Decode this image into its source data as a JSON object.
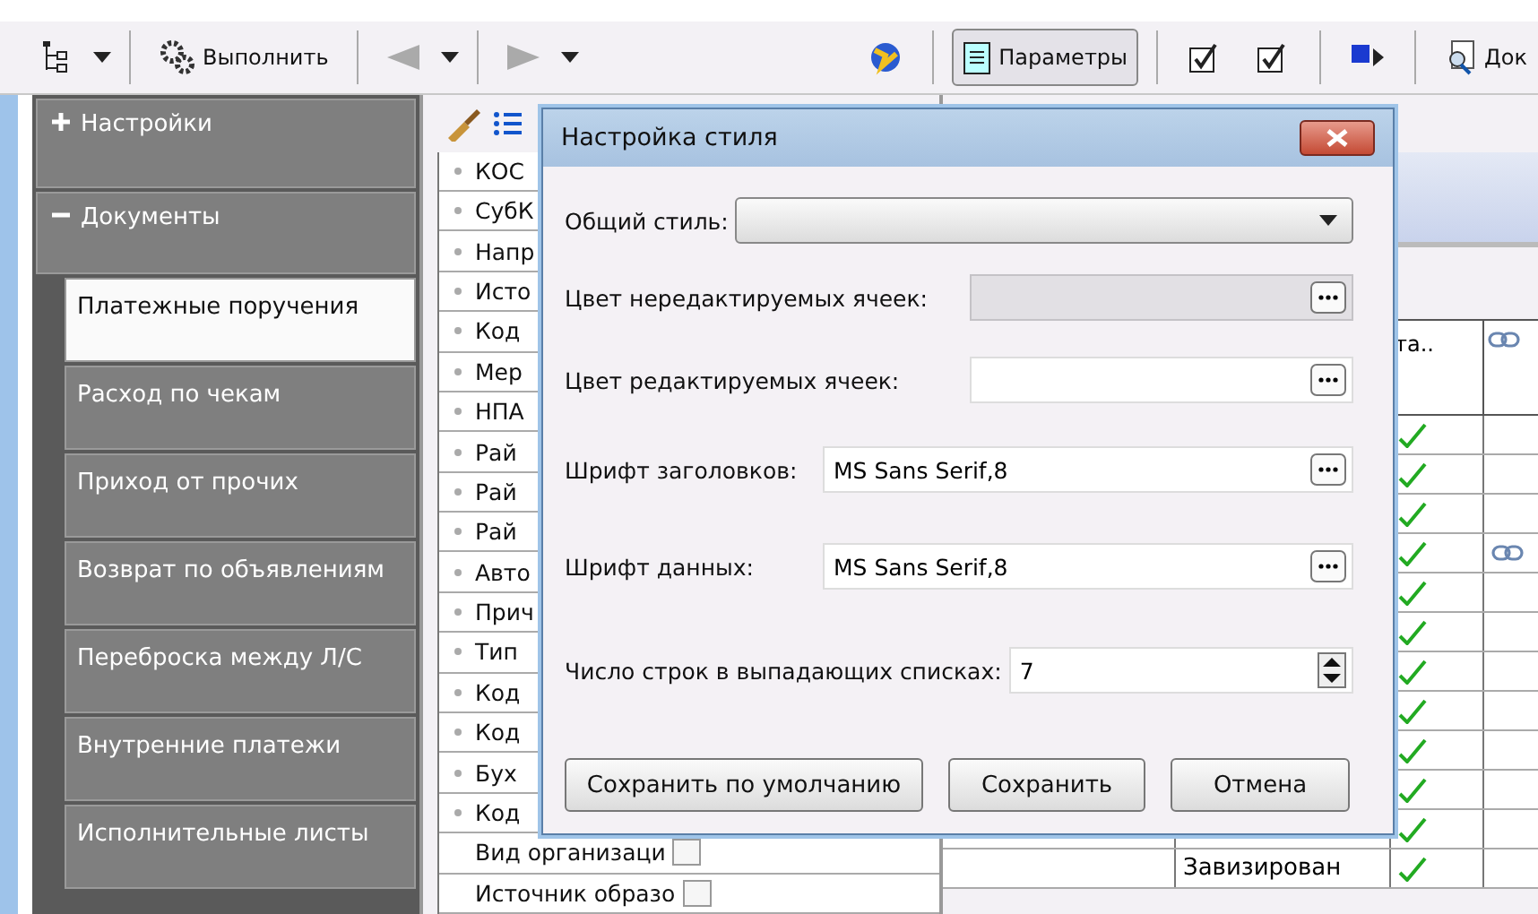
{
  "toolbar": {
    "execute_label": "Выполнить",
    "back_disabled": true,
    "forward_disabled": true,
    "params": {
      "label": "Параметры",
      "pressed": true
    },
    "doc_label": "Док"
  },
  "sidebar": {
    "groups": [
      {
        "label": "Настройки",
        "expanded": false
      },
      {
        "label": "Документы",
        "expanded": true,
        "items": [
          {
            "label": "Платежные поручения",
            "selected": true
          },
          {
            "label": "Расход по чекам",
            "selected": false
          },
          {
            "label": "Приход от прочих",
            "selected": false
          },
          {
            "label": "Возврат по объявлениям",
            "selected": false
          },
          {
            "label": "Переброска между Л/С",
            "selected": false
          },
          {
            "label": "Внутренние платежи",
            "selected": false
          },
          {
            "label": "Исполнительные листы",
            "selected": false
          }
        ]
      }
    ]
  },
  "fields_list": [
    {
      "kind": "dot",
      "label": "КОС"
    },
    {
      "kind": "dot",
      "label": "СубК"
    },
    {
      "kind": "dot",
      "label": "Напр"
    },
    {
      "kind": "dot",
      "label": "Исто"
    },
    {
      "kind": "dot",
      "label": "Код"
    },
    {
      "kind": "dot",
      "label": "Мер"
    },
    {
      "kind": "dot",
      "label": "НПА"
    },
    {
      "kind": "dot",
      "label": "Рай"
    },
    {
      "kind": "dot",
      "label": "Рай"
    },
    {
      "kind": "dot",
      "label": "Рай"
    },
    {
      "kind": "dot",
      "label": "Авто"
    },
    {
      "kind": "dot",
      "label": "Прич"
    },
    {
      "kind": "dot",
      "label": "Тип"
    },
    {
      "kind": "dot",
      "label": "Код"
    },
    {
      "kind": "dot",
      "label": "Код"
    },
    {
      "kind": "dot",
      "label": "Бух"
    },
    {
      "kind": "dot",
      "label": "Код"
    },
    {
      "kind": "check",
      "label": "Вид организаци",
      "checked": false
    },
    {
      "kind": "check",
      "label": "Источник образо",
      "checked": false
    }
  ],
  "grid": {
    "header": "та..",
    "rows": [
      {
        "checked": true,
        "linked": false
      },
      {
        "checked": true,
        "linked": false
      },
      {
        "checked": true,
        "linked": false
      },
      {
        "checked": true,
        "linked": true
      },
      {
        "checked": true,
        "linked": false
      },
      {
        "checked": true,
        "linked": false
      },
      {
        "checked": true,
        "linked": false
      },
      {
        "checked": true,
        "linked": false
      },
      {
        "checked": true,
        "linked": false
      },
      {
        "checked": true,
        "linked": false
      },
      {
        "checked": true,
        "linked": false
      },
      {
        "checked": true,
        "linked": false,
        "status": "Завизирован"
      }
    ]
  },
  "dialog": {
    "title": "Настройка стиля",
    "fields": [
      {
        "kind": "select",
        "label": "Общий стиль:"
      },
      {
        "kind": "color",
        "label": "Цвет нередактируемых ячеек:",
        "disabled": true
      },
      {
        "kind": "color",
        "label": "Цвет редактируемых ячеек:",
        "disabled": false
      },
      {
        "kind": "font",
        "label": "Шрифт заголовков:",
        "value": "MS Sans Serif,8"
      },
      {
        "kind": "font",
        "label": "Шрифт данных:",
        "value": "MS Sans Serif,8"
      },
      {
        "kind": "spin",
        "label": "Число строк в выпадающих списках:",
        "value": "7"
      }
    ],
    "buttons": [
      "Сохранить по умолчанию",
      "Сохранить",
      "Отмена"
    ]
  }
}
